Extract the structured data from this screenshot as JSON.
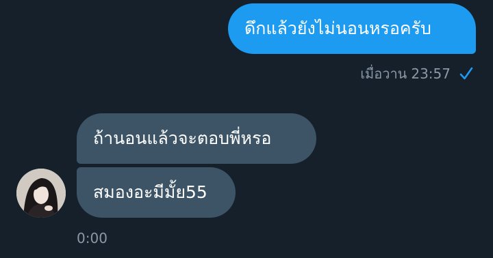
{
  "conversation": {
    "messages": [
      {
        "direction": "outgoing",
        "text": "ดึกแล้วยังไม่นอนหรอครับ",
        "date_label": "เมื่อวาน",
        "time": "23:57",
        "status_icon": "check-icon"
      },
      {
        "direction": "incoming",
        "text": "ถ้านอนแล้วจะตอบพี่หรอ"
      },
      {
        "direction": "incoming",
        "text": "สมองอะมีมั้ย55",
        "time": "0:00"
      }
    ]
  },
  "colors": {
    "background": "#15202b",
    "outgoing_bubble": "#1d9bf0",
    "incoming_bubble": "#3d5466",
    "meta_text": "#8b98a5",
    "accent": "#1d9bf0"
  }
}
